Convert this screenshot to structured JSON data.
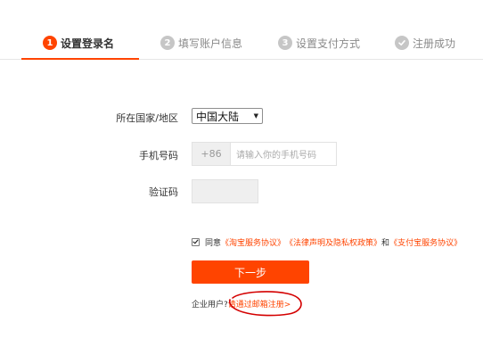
{
  "steps": [
    {
      "num": "1",
      "label": "设置登录名",
      "active": true
    },
    {
      "num": "2",
      "label": "填写账户信息",
      "active": false
    },
    {
      "num": "3",
      "label": "设置支付方式",
      "active": false
    },
    {
      "label": "注册成功",
      "icon": "check-circle-icon",
      "active": false
    }
  ],
  "form": {
    "country_label": "所在国家/地区",
    "country_value": "中国大陆",
    "phone_label": "手机号码",
    "phone_prefix": "+86",
    "phone_placeholder": "请输入你的手机号码",
    "code_label": "验证码"
  },
  "agreement": {
    "checked": true,
    "prefix": "同意",
    "links": [
      "《淘宝服务协议》",
      "《法律声明及隐私权政策》",
      "《支付宝服务协议》"
    ],
    "and_text": "和"
  },
  "next_button": "下一步",
  "enterprise": {
    "label": "企业用户?",
    "link": "请通过邮箱注册>"
  },
  "colors": {
    "accent": "#ff4400",
    "annotation": "#d40000"
  }
}
